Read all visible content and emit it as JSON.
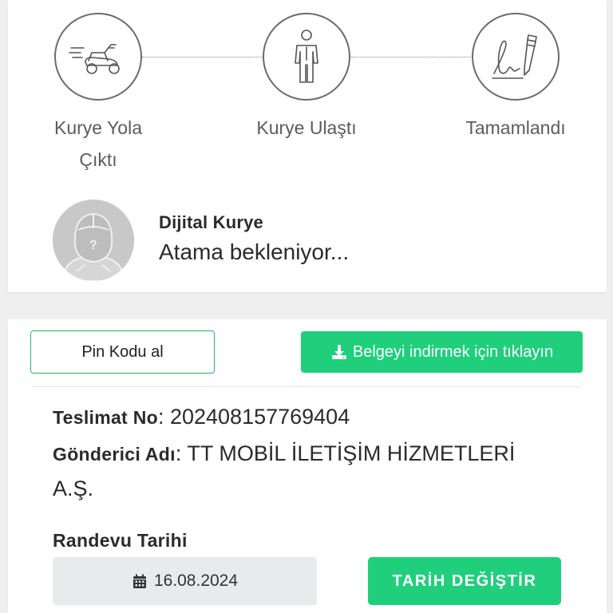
{
  "steps": [
    {
      "label_line1": "Kurye Yola",
      "label_line2": "Çıktı",
      "icon": "scooter-icon"
    },
    {
      "label": "Kurye Ulaştı",
      "icon": "person-icon"
    },
    {
      "label": "Tamamlandı",
      "icon": "signature-icon"
    }
  ],
  "courier": {
    "name": "Dijital Kurye",
    "status": "Atama bekleniyor...",
    "avatar_icon": "unknown-courier-avatar"
  },
  "actions": {
    "pin_label": "Pin Kodu al",
    "download_label": "Belgeyi indirmek için tıklayın",
    "download_icon": "download-icon"
  },
  "delivery": {
    "tracking_key": "Teslimat No",
    "tracking_value": ": 202408157769404",
    "sender_key": "Gönderici Adı",
    "sender_value_line1": ": TT MOBİL İLETİŞİM HİZMETLERİ",
    "sender_value_line2": "A.Ş."
  },
  "appointment": {
    "label": "Randevu Tarihi",
    "date": "16.08.2024",
    "calendar_icon": "calendar-icon",
    "change_label": "TARİH DEĞİŞTİR"
  },
  "colors": {
    "accent": "#1fcf7b",
    "outline": "#22b573",
    "step_border": "#6b6b6b"
  }
}
